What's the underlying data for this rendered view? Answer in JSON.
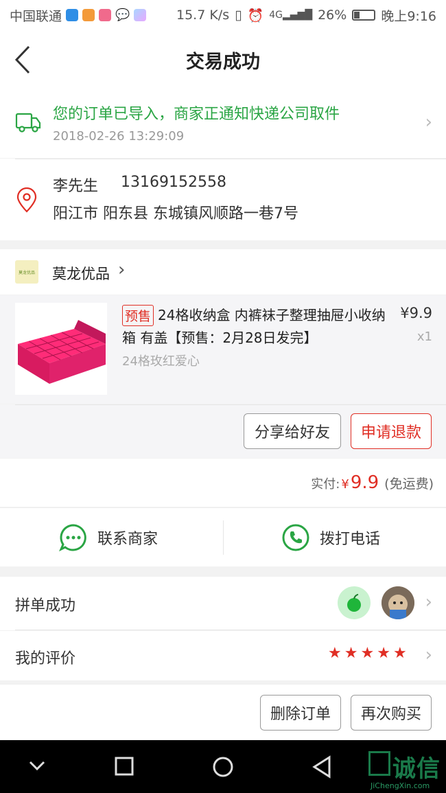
{
  "status_bar": {
    "carrier": "中国联通",
    "net_speed": "15.7 K/s",
    "network": "4G",
    "battery": "26%",
    "time": "晚上9:16"
  },
  "header": {
    "title": "交易成功"
  },
  "logistics": {
    "status": "您的订单已导入，商家正通知快递公司取件",
    "time": "2018-02-26 13:29:09"
  },
  "address": {
    "name": "李先生",
    "phone": "13169152558",
    "line": "阳江市 阳东县 东城镇风顺路一巷7号"
  },
  "store": {
    "name": "莫龙优品",
    "logo_text": "莫龙优品"
  },
  "product": {
    "tag": "预售",
    "title": "24格收纳盒 内裤袜子整理抽屉小收纳箱 有盖【预售：2月28日发完】",
    "sku": "24格玫红爱心",
    "price": "¥9.9",
    "qty": "x1"
  },
  "order_actions": {
    "share": "分享给好友",
    "refund": "申请退款"
  },
  "payment": {
    "label": "实付:",
    "symbol": "¥",
    "amount": "9.9",
    "note": "(免运费)"
  },
  "contact": {
    "merchant": "联系商家",
    "phone": "拨打电话"
  },
  "group": {
    "label": "拼单成功"
  },
  "review": {
    "label": "我的评价",
    "rating": 5
  },
  "bottom_actions": {
    "delete": "删除订单",
    "rebuy": "再次购买"
  },
  "watermark": {
    "text": "诚信",
    "sub": "JiChengXin.com"
  },
  "colors": {
    "accent_red": "#e02e24",
    "success_green": "#2aa544"
  }
}
